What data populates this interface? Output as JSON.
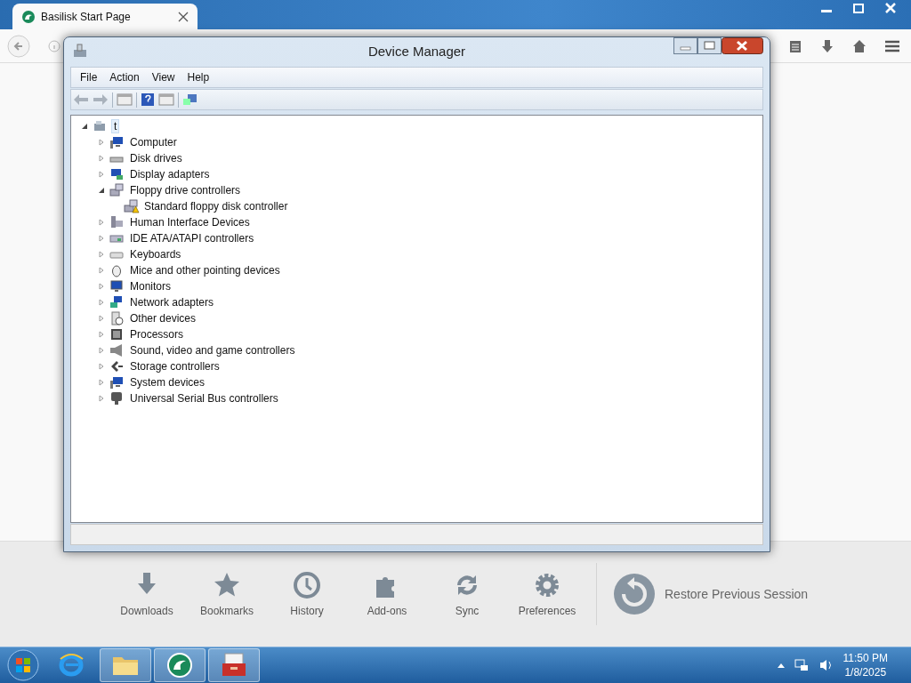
{
  "browser": {
    "tab": {
      "title": "Basilisk Start Page"
    },
    "launcher": [
      {
        "label": "Downloads",
        "kind": "downloads"
      },
      {
        "label": "Bookmarks",
        "kind": "bookmarks"
      },
      {
        "label": "History",
        "kind": "history"
      },
      {
        "label": "Add-ons",
        "kind": "addons"
      },
      {
        "label": "Sync",
        "kind": "sync"
      },
      {
        "label": "Preferences",
        "kind": "preferences"
      }
    ],
    "restore": {
      "label": "Restore Previous Session"
    }
  },
  "device_manager": {
    "title": "Device Manager",
    "menu": [
      "File",
      "Action",
      "View",
      "Help"
    ],
    "tree": {
      "label": "t",
      "kind": "pc",
      "expanded": true,
      "children": [
        {
          "label": "Computer",
          "kind": "computer",
          "expanded": false
        },
        {
          "label": "Disk drives",
          "kind": "disk",
          "expanded": false
        },
        {
          "label": "Display adapters",
          "kind": "display",
          "expanded": false
        },
        {
          "label": "Floppy drive controllers",
          "kind": "floppy",
          "expanded": true,
          "children": [
            {
              "label": "Standard floppy disk controller",
              "kind": "floppy",
              "warning": true
            }
          ]
        },
        {
          "label": "Human Interface Devices",
          "kind": "hid",
          "expanded": false
        },
        {
          "label": "IDE ATA/ATAPI controllers",
          "kind": "ide",
          "expanded": false
        },
        {
          "label": "Keyboards",
          "kind": "keyboard",
          "expanded": false
        },
        {
          "label": "Mice and other pointing devices",
          "kind": "mouse",
          "expanded": false
        },
        {
          "label": "Monitors",
          "kind": "monitor",
          "expanded": false
        },
        {
          "label": "Network adapters",
          "kind": "network",
          "expanded": false
        },
        {
          "label": "Other devices",
          "kind": "other",
          "expanded": false
        },
        {
          "label": "Processors",
          "kind": "cpu",
          "expanded": false
        },
        {
          "label": "Sound, video and game controllers",
          "kind": "sound",
          "expanded": false
        },
        {
          "label": "Storage controllers",
          "kind": "storage",
          "expanded": false
        },
        {
          "label": "System devices",
          "kind": "computer",
          "expanded": false
        },
        {
          "label": "Universal Serial Bus controllers",
          "kind": "usb",
          "expanded": false
        }
      ]
    }
  },
  "taskbar": {
    "apps": [
      {
        "kind": "ie",
        "running": false
      },
      {
        "kind": "folder",
        "running": true
      },
      {
        "kind": "basilisk",
        "running": true
      },
      {
        "kind": "toolbox",
        "running": true
      }
    ],
    "time": "11:50 PM",
    "date": "1/8/2025"
  }
}
